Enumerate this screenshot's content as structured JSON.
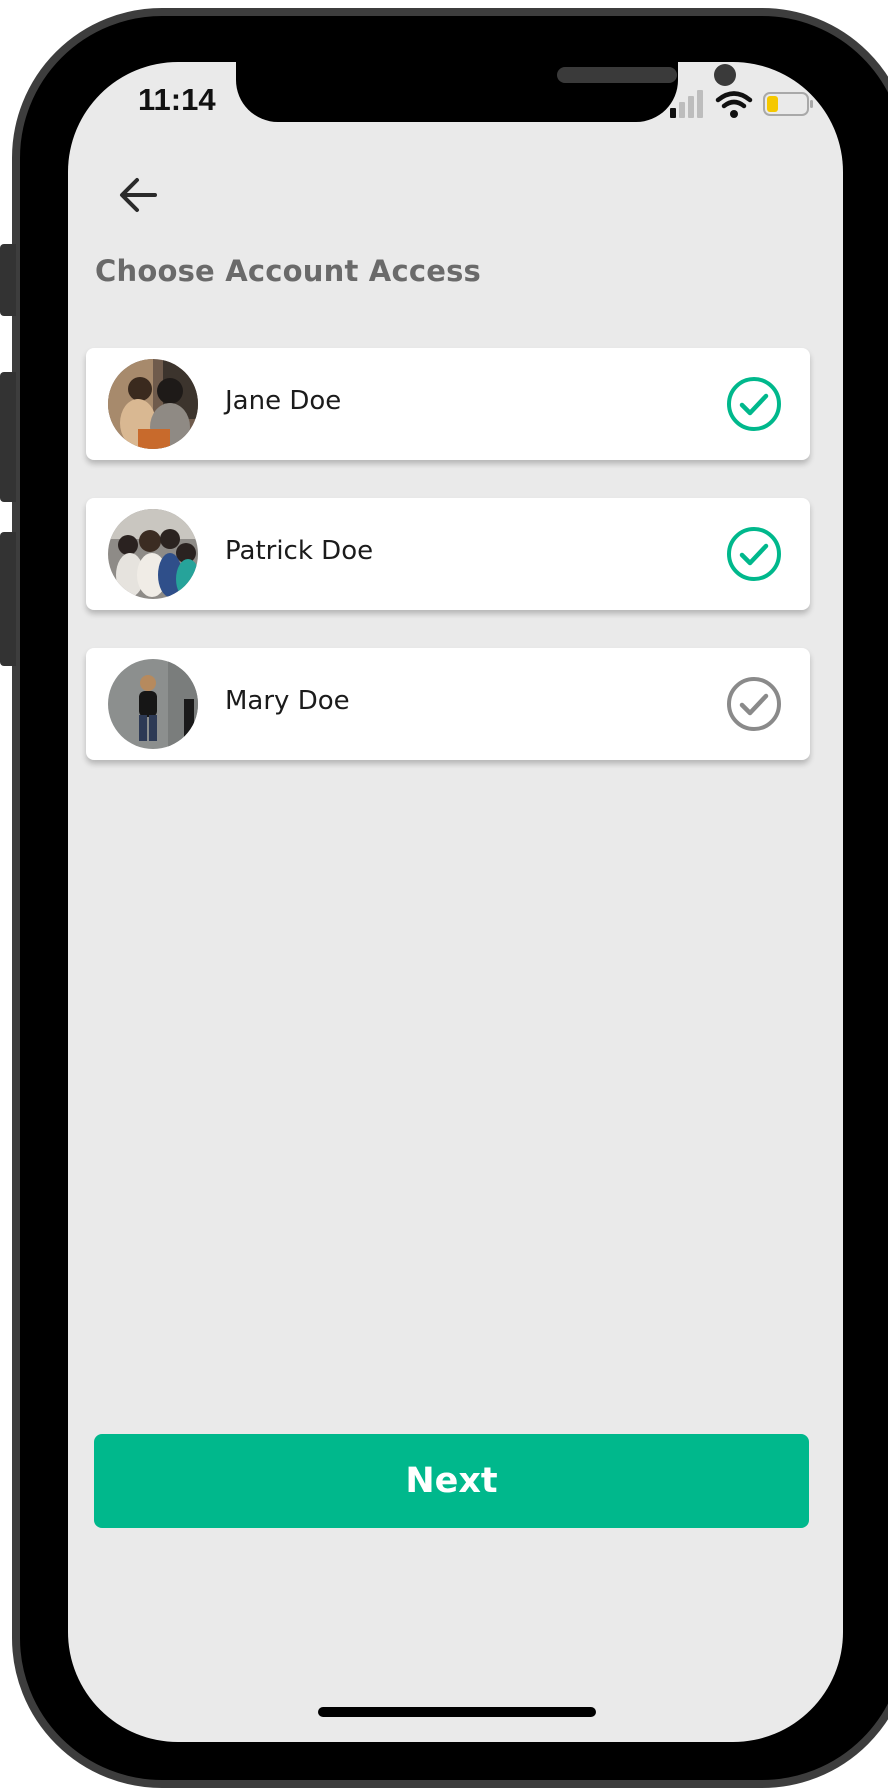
{
  "status_bar": {
    "time": "11:14",
    "signal_icon": "cellular-signal-icon",
    "wifi_icon": "wifi-icon",
    "battery_icon": "battery-low-icon"
  },
  "header": {
    "back_icon": "arrow-left-icon",
    "title": "Choose Account Access"
  },
  "accounts": [
    {
      "name": "Jane Doe",
      "selected": true
    },
    {
      "name": "Patrick Doe",
      "selected": true
    },
    {
      "name": "Mary Doe",
      "selected": false
    }
  ],
  "actions": {
    "next_label": "Next"
  },
  "colors": {
    "accent": "#00b88c",
    "unselected": "#8a8a8a",
    "background": "#eaeaea"
  }
}
